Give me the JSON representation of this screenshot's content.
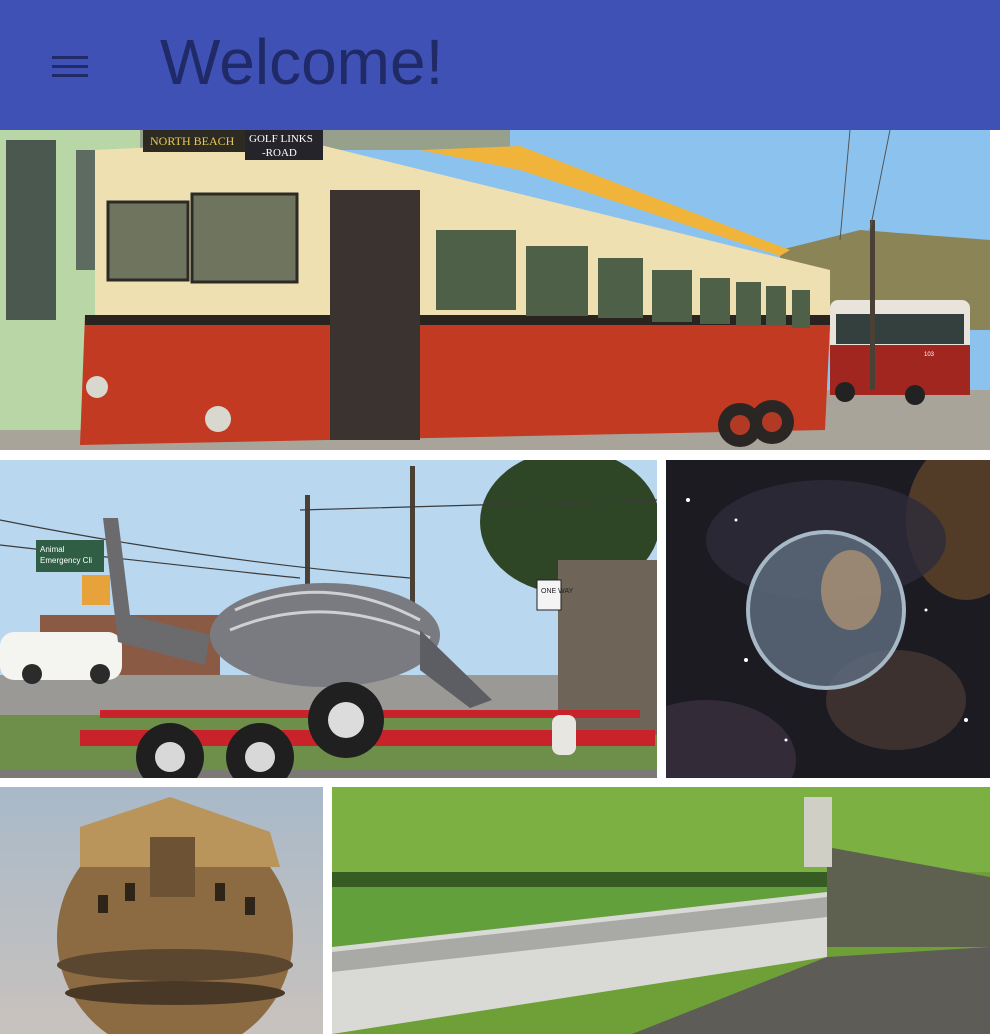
{
  "appbar": {
    "title": "Welcome!",
    "menu_icon": "hamburger-menu-icon",
    "background": "#3f51b5",
    "title_color": "#1f2a66"
  },
  "gallery": {
    "tiles": [
      {
        "name": "trolleybus-photo",
        "signs": {
          "route": "NORTH BEACH",
          "street": "GOLF LINKS ROAD",
          "street_line2": "-ROAD"
        },
        "fleet_number": "103"
      },
      {
        "name": "armadillo-sculpture-photo",
        "signs": {
          "clinic": "Animal Emergency Clinic",
          "one_way": "ONE WAY"
        }
      },
      {
        "name": "bubble-nebula-photo"
      },
      {
        "name": "water-tower-photo"
      },
      {
        "name": "waterfall-dam-photo"
      }
    ]
  }
}
